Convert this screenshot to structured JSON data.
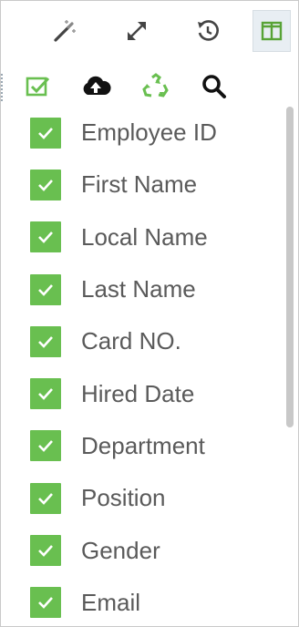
{
  "topbar": {
    "buttons": [
      {
        "icon": "magic-wand-icon"
      },
      {
        "icon": "expand-arrows-icon"
      },
      {
        "icon": "history-icon"
      },
      {
        "icon": "columns-icon",
        "active": true
      }
    ]
  },
  "toolbar": {
    "buttons": [
      {
        "icon": "select-all-checkbox-icon"
      },
      {
        "icon": "cloud-upload-icon"
      },
      {
        "icon": "recycle-icon"
      },
      {
        "icon": "search-icon"
      }
    ]
  },
  "columns": [
    {
      "label": "Employee ID",
      "checked": true
    },
    {
      "label": "First Name",
      "checked": true
    },
    {
      "label": "Local Name",
      "checked": true
    },
    {
      "label": "Last Name",
      "checked": true
    },
    {
      "label": "Card NO.",
      "checked": true
    },
    {
      "label": "Hired Date",
      "checked": true
    },
    {
      "label": "Department",
      "checked": true
    },
    {
      "label": "Position",
      "checked": true
    },
    {
      "label": "Gender",
      "checked": true
    },
    {
      "label": "Email",
      "checked": true
    }
  ],
  "colors": {
    "checkbox_green": "#69bf50",
    "label_gray": "#5a5a5a",
    "active_bg": "#e8eef3"
  }
}
